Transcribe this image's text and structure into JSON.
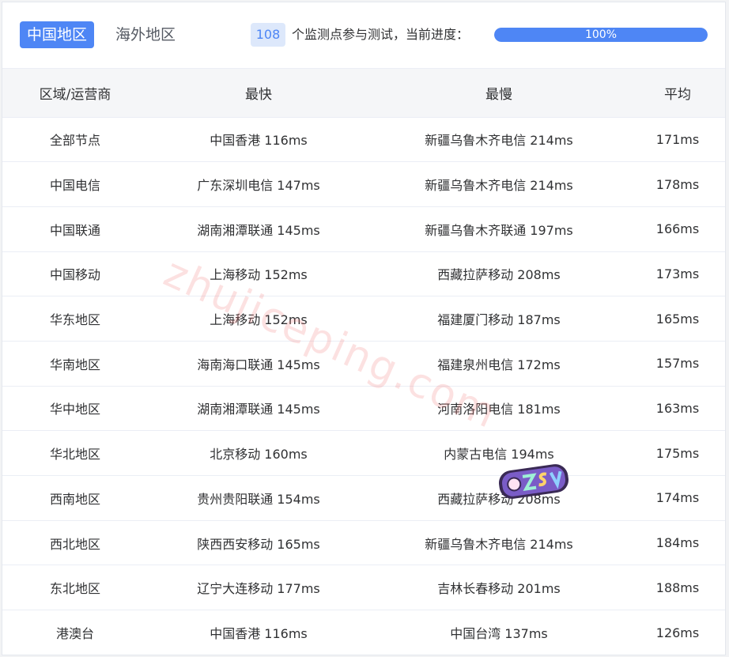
{
  "tabs": {
    "active": "中国地区",
    "inactive": "海外地区"
  },
  "progress": {
    "node_count": "108",
    "text": "个监测点参与测试，当前进度：",
    "percent_label": "100%",
    "fraction": 1.0
  },
  "table": {
    "headers": [
      "区域/运营商",
      "最快",
      "最慢",
      "平均"
    ],
    "rows": [
      [
        "全部节点",
        "中国香港 116ms",
        "新疆乌鲁木齐电信 214ms",
        "171ms"
      ],
      [
        "中国电信",
        "广东深圳电信 147ms",
        "新疆乌鲁木齐电信 214ms",
        "178ms"
      ],
      [
        "中国联通",
        "湖南湘潭联通 145ms",
        "新疆乌鲁木齐联通 197ms",
        "166ms"
      ],
      [
        "中国移动",
        "上海移动 152ms",
        "西藏拉萨移动 208ms",
        "173ms"
      ],
      [
        "华东地区",
        "上海移动 152ms",
        "福建厦门移动 187ms",
        "165ms"
      ],
      [
        "华南地区",
        "海南海口联通 145ms",
        "福建泉州电信 172ms",
        "157ms"
      ],
      [
        "华中地区",
        "湖南湘潭联通 145ms",
        "河南洛阳电信 181ms",
        "163ms"
      ],
      [
        "华北地区",
        "北京移动 160ms",
        "内蒙古电信 194ms",
        "175ms"
      ],
      [
        "西南地区",
        "贵州贵阳联通 154ms",
        "西藏拉萨移动 208ms",
        "174ms"
      ],
      [
        "西北地区",
        "陕西西安移动 165ms",
        "新疆乌鲁木齐电信 214ms",
        "184ms"
      ],
      [
        "东北地区",
        "辽宁大连移动 177ms",
        "吉林长春移动 201ms",
        "188ms"
      ],
      [
        "港澳台",
        "中国香港 116ms",
        "中国台湾 137ms",
        "126ms"
      ]
    ]
  },
  "watermark": "zhujiceping.com",
  "sticker_logo_text": "OZSV",
  "colors": {
    "accent": "#4e86f5",
    "badge_bg": "#dde8fb",
    "header_bg": "#f5f6f8",
    "watermark": "#f07878"
  }
}
